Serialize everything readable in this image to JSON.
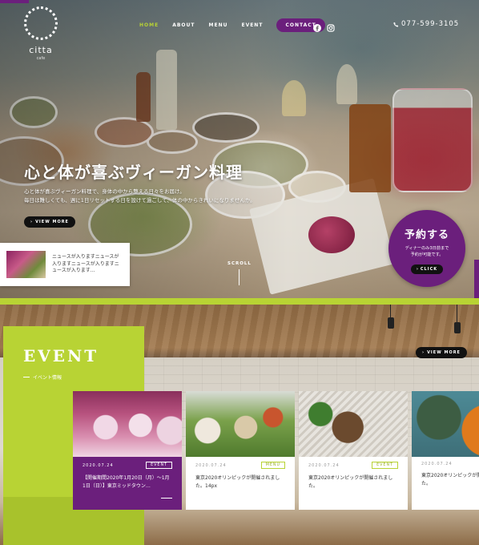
{
  "logo": {
    "name": "citta",
    "sub": "cafe"
  },
  "nav": {
    "items": [
      {
        "label": "HOME",
        "active": true
      },
      {
        "label": "ABOUT",
        "active": false
      },
      {
        "label": "MENU",
        "active": false
      },
      {
        "label": "EVENT",
        "active": false
      }
    ],
    "contact_label": "CONTACT",
    "phone": "077-599-3105",
    "social_icons": [
      "facebook-icon",
      "instagram-icon"
    ]
  },
  "hero": {
    "title": "心と体が喜ぶヴィーガン料理",
    "text_line1": "心と体が喜ぶヴィーガン料理で、身体の中から整える日々をお届け。",
    "text_line2": "毎日は難しくても、週に1日リセットする日を設けて過ごして、体の中からきれいになりませんか。",
    "view_more": "VIEW MORE",
    "scroll": "SCROLL"
  },
  "news": {
    "text": "ニュースが入りますニュースが入りますニュースが入りますニュースが入ります…"
  },
  "reserve": {
    "title": "予約する",
    "note_line1": "ディナーのみ3日前まで",
    "note_line2": "予約が可能です。",
    "button": "CLICK"
  },
  "event": {
    "title": "EVENT",
    "subtitle": "イベント情報",
    "view_more": "VIEW MORE",
    "cards": [
      {
        "date": "2020.07.24",
        "tag": "EVENT",
        "text": "【開催期間2020年1月20日（月）〜1月1日（日）】東京ミッドタウン…",
        "featured": true
      },
      {
        "date": "2020.07.24",
        "tag": "MENU",
        "text": "東京2020オリンピックが開催されました。14px",
        "featured": false
      },
      {
        "date": "2020.07.24",
        "tag": "EVENT",
        "text": "東京2020オリンピックが開催されました。",
        "featured": false
      },
      {
        "date": "2020.07.24",
        "tag": "",
        "text": "東京2020オリンピックが開催されました。",
        "featured": false
      }
    ]
  },
  "colors": {
    "accent_green": "#b8d334",
    "brand_purple": "#6b1f7c",
    "dark": "#111111"
  }
}
